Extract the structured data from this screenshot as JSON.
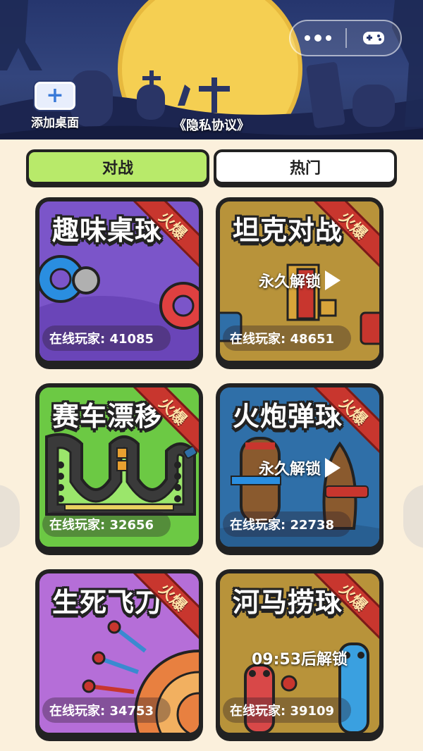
{
  "header": {
    "add_desktop_label": "添加桌面",
    "privacy_link": "《隐私协议》",
    "capsule_icons": [
      "more-dots-icon",
      "gamepad-icon"
    ]
  },
  "tabs": [
    {
      "label": "对战",
      "active": true
    },
    {
      "label": "热门",
      "active": false
    }
  ],
  "ribbon_text": "火爆",
  "games": [
    {
      "title": "趣味桌球",
      "online": "在线玩家: 41085",
      "locked": false,
      "lock_text": "",
      "bg": "#7b55c9"
    },
    {
      "title": "坦克对战",
      "online": "在线玩家: 48651",
      "locked": true,
      "lock_text": "永久解锁",
      "bg": "#b8933a"
    },
    {
      "title": "赛车漂移",
      "online": "在线玩家: 32656",
      "locked": false,
      "lock_text": "",
      "bg": "#6cc944"
    },
    {
      "title": "火炮弹球",
      "online": "在线玩家: 22738",
      "locked": true,
      "lock_text": "永久解锁",
      "bg": "#2f6fa8"
    },
    {
      "title": "生死飞刀",
      "online": "在线玩家: 34753",
      "locked": false,
      "lock_text": "",
      "bg": "#b56ed8"
    },
    {
      "title": "河马捞球",
      "online": "在线玩家: 39109",
      "locked": true,
      "lock_text": "09:53后解锁",
      "bg": "#b8933a"
    }
  ],
  "colors": {
    "page_bg": "#fbf0dc",
    "tab_active": "#b8ea6a",
    "ribbon": "#c8362e"
  }
}
